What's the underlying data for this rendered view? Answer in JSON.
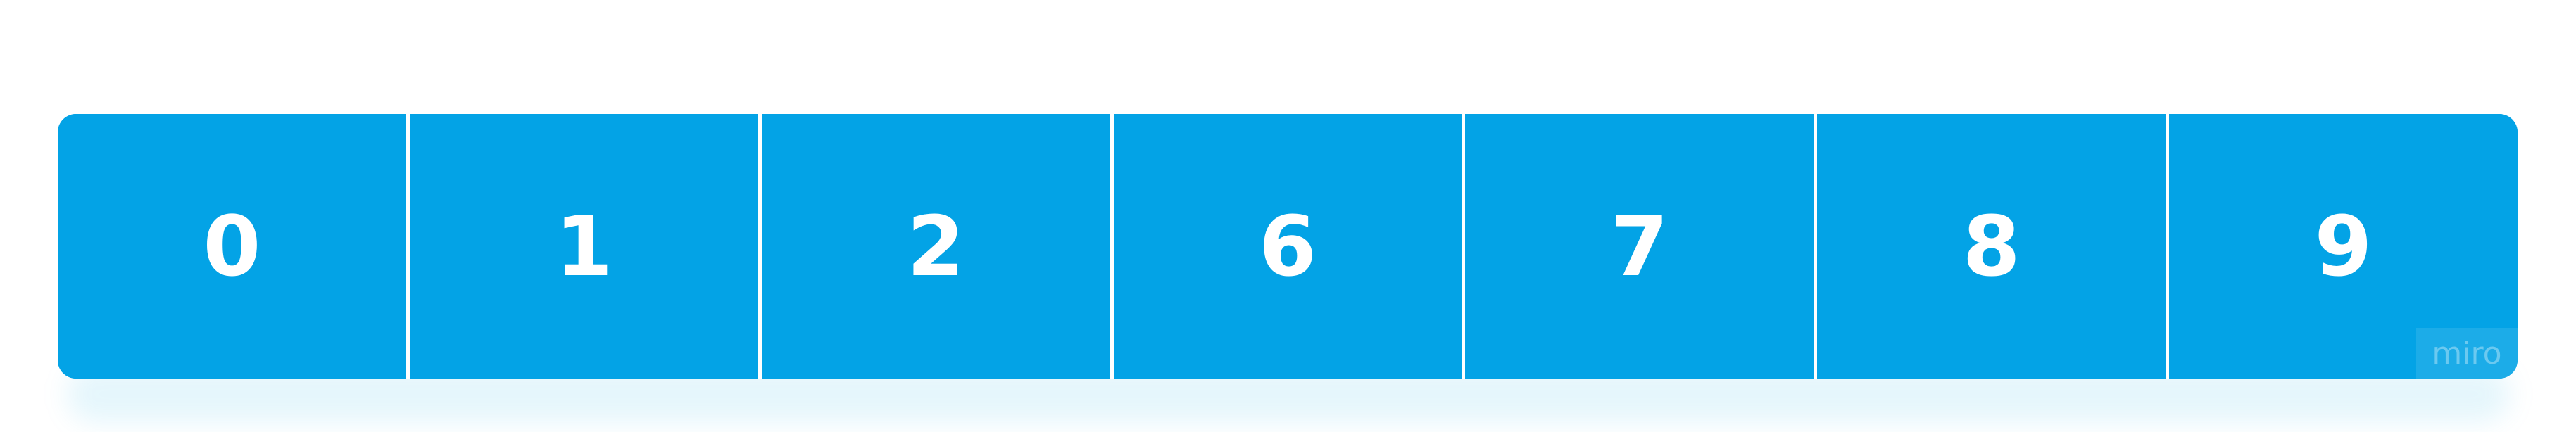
{
  "diagram": {
    "cells": [
      "0",
      "1",
      "2",
      "6",
      "7",
      "8",
      "9"
    ],
    "fill_color": "#03a3e6",
    "divider_color": "#ffffff",
    "text_color": "#ffffff"
  },
  "watermark": {
    "text": "miro"
  }
}
